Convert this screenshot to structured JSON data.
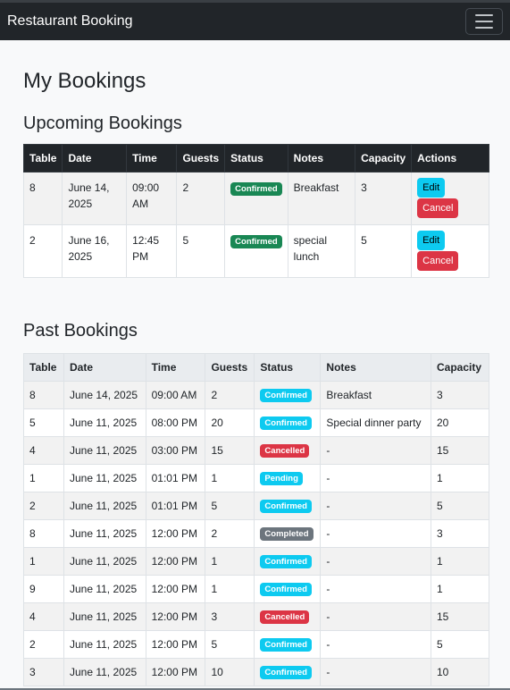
{
  "nav": {
    "brand": "Restaurant Booking",
    "toggler_icon": "hamburger-icon"
  },
  "page_title": "My Bookings",
  "upcoming": {
    "heading": "Upcoming Bookings",
    "columns": [
      "Table",
      "Date",
      "Time",
      "Guests",
      "Status",
      "Notes",
      "Capacity",
      "Actions"
    ],
    "rows": [
      {
        "table": "8",
        "date": "June 14, 2025",
        "time": "09:00 AM",
        "guests": "2",
        "status": "Confirmed",
        "notes": "Breakfast",
        "capacity": "3",
        "edit": "Edit",
        "cancel": "Cancel"
      },
      {
        "table": "2",
        "date": "June 16, 2025",
        "time": "12:45 PM",
        "guests": "5",
        "status": "Confirmed",
        "notes": "special lunch",
        "capacity": "5",
        "edit": "Edit",
        "cancel": "Cancel"
      }
    ]
  },
  "past": {
    "heading": "Past Bookings",
    "columns": [
      "Table",
      "Date",
      "Time",
      "Guests",
      "Status",
      "Notes",
      "Capacity"
    ],
    "rows": [
      {
        "table": "8",
        "date": "June 14, 2025",
        "time": "09:00 AM",
        "guests": "2",
        "status": "Confirmed",
        "notes": "Breakfast",
        "capacity": "3"
      },
      {
        "table": "5",
        "date": "June 11, 2025",
        "time": "08:00 PM",
        "guests": "20",
        "status": "Confirmed",
        "notes": "Special dinner party",
        "capacity": "20"
      },
      {
        "table": "4",
        "date": "June 11, 2025",
        "time": "03:00 PM",
        "guests": "15",
        "status": "Cancelled",
        "notes": "-",
        "capacity": "15"
      },
      {
        "table": "1",
        "date": "June 11, 2025",
        "time": "01:01 PM",
        "guests": "1",
        "status": "Pending",
        "notes": "-",
        "capacity": "1"
      },
      {
        "table": "2",
        "date": "June 11, 2025",
        "time": "01:01 PM",
        "guests": "5",
        "status": "Confirmed",
        "notes": "-",
        "capacity": "5"
      },
      {
        "table": "8",
        "date": "June 11, 2025",
        "time": "12:00 PM",
        "guests": "2",
        "status": "Completed",
        "notes": "-",
        "capacity": "3"
      },
      {
        "table": "1",
        "date": "June 11, 2025",
        "time": "12:00 PM",
        "guests": "1",
        "status": "Confirmed",
        "notes": "-",
        "capacity": "1"
      },
      {
        "table": "9",
        "date": "June 11, 2025",
        "time": "12:00 PM",
        "guests": "1",
        "status": "Confirmed",
        "notes": "-",
        "capacity": "1"
      },
      {
        "table": "4",
        "date": "June 11, 2025",
        "time": "12:00 PM",
        "guests": "3",
        "status": "Cancelled",
        "notes": "-",
        "capacity": "15"
      },
      {
        "table": "2",
        "date": "June 11, 2025",
        "time": "12:00 PM",
        "guests": "5",
        "status": "Confirmed",
        "notes": "-",
        "capacity": "5"
      },
      {
        "table": "3",
        "date": "June 11, 2025",
        "time": "12:00 PM",
        "guests": "10",
        "status": "Confirmed",
        "notes": "-",
        "capacity": "10"
      }
    ]
  },
  "colors": {
    "navbar": "#212529",
    "confirmed_upcoming": "#198754",
    "confirmed_past": "#0dcaf0",
    "cancelled": "#dc3545",
    "completed": "#6c757d"
  }
}
